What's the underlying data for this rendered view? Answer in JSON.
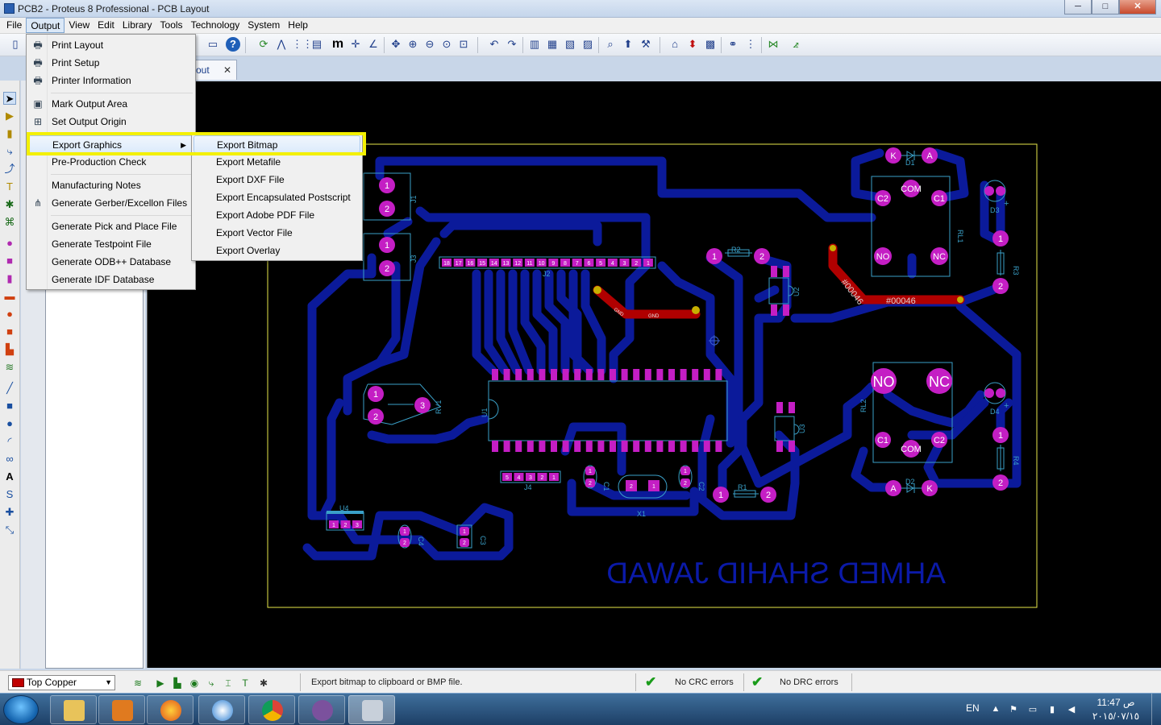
{
  "window": {
    "title": "PCB2 - Proteus 8 Professional - PCB Layout",
    "min": "─",
    "max": "□",
    "close": "✕"
  },
  "menubar": [
    "File",
    "Output",
    "View",
    "Edit",
    "Library",
    "Tools",
    "Technology",
    "System",
    "Help"
  ],
  "tab": {
    "label": "out",
    "close": "✕"
  },
  "output_menu": {
    "items": [
      {
        "label": "Print Layout",
        "icon": "printer-icon",
        "glyph": "🖶"
      },
      {
        "label": "Print Setup",
        "icon": "printer-setup-icon",
        "glyph": "🖶"
      },
      {
        "label": "Printer Information",
        "icon": "printer-info-icon",
        "glyph": "🖶"
      },
      {
        "label": "Mark Output Area",
        "icon": "mark-area-icon",
        "glyph": "▣"
      },
      {
        "label": "Set Output Origin",
        "icon": "origin-icon",
        "glyph": "⊞"
      },
      {
        "label": "Export Graphics",
        "icon": "",
        "glyph": ""
      },
      {
        "label": "Pre-Production Check",
        "icon": "",
        "glyph": ""
      },
      {
        "label": "Manufacturing Notes",
        "icon": "",
        "glyph": ""
      },
      {
        "label": "Generate Gerber/Excellon Files",
        "icon": "gerber-icon",
        "glyph": "⋔"
      },
      {
        "label": "Generate Pick and Place File",
        "icon": "",
        "glyph": ""
      },
      {
        "label": "Generate Testpoint File",
        "icon": "",
        "glyph": ""
      },
      {
        "label": "Generate ODB++ Database",
        "icon": "",
        "glyph": ""
      },
      {
        "label": "Generate IDF Database",
        "icon": "",
        "glyph": ""
      }
    ],
    "submenu_arrow": "▶"
  },
  "export_submenu": [
    "Export Bitmap",
    "Export Metafile",
    "Export DXF File",
    "Export Encapsulated Postscript",
    "Export Adobe PDF File",
    "Export Vector File",
    "Export Overlay"
  ],
  "status": {
    "layer": "Top Copper",
    "message": "Export bitmap to clipboard or BMP file.",
    "crc": "No CRC errors",
    "drc": "No DRC errors"
  },
  "pcb": {
    "labels": {
      "j1": "J1",
      "j3": "J3",
      "j2": "J2",
      "j4": "J4",
      "u1": "U1",
      "u2": "U2",
      "u3": "U3",
      "u4": "U4",
      "rv1": "RV1",
      "r1": "R1",
      "r2": "R2",
      "r3": "R3",
      "r4": "R4",
      "c1": "C1",
      "c2": "C2",
      "c3": "C3",
      "c4": "C4",
      "d1": "D1",
      "d2": "D2",
      "d3": "D3",
      "d4": "D4",
      "rl1": "RL1",
      "rl2": "RL2",
      "x1": "X1",
      "com": "COM",
      "no": "NO",
      "nc": "NC",
      "c1pin": "C1",
      "c2pin": "C2",
      "k": "K",
      "a": "A",
      "gnd": "GND",
      "net": "#00046",
      "signature": "AHMED SHAHID JAWAD"
    },
    "j2_pins": [
      "18",
      "17",
      "16",
      "15",
      "14",
      "13",
      "12",
      "11",
      "10",
      "9",
      "8",
      "7",
      "6",
      "5",
      "4",
      "3",
      "2",
      "1"
    ],
    "j4_pins": [
      "5",
      "4",
      "3",
      "2",
      "1"
    ],
    "u4_pins": [
      "1",
      "2",
      "3"
    ]
  },
  "taskbar": {
    "lang": "EN",
    "time": "11:47 ص",
    "date": "٢٠١٥/٠٧/١٥"
  },
  "colors": {
    "track": "#0b1a9a",
    "pad": "#c41ec4",
    "silk": "#3aa0c8",
    "red_track": "#b00000",
    "highlight": "#f3f000"
  }
}
